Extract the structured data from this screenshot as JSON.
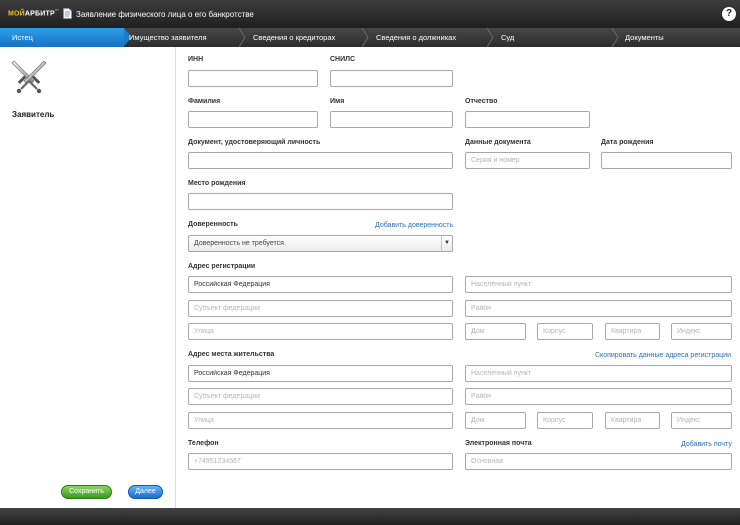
{
  "app": {
    "logo_prefix": "МОЙ",
    "logo_main": "АРБИТР",
    "logo_tm": "™",
    "title": "Заявление физического лица о его банкротстве",
    "help": "?"
  },
  "steps": [
    {
      "label": "Истец",
      "active": true
    },
    {
      "label": "Имущество заявителя"
    },
    {
      "label": "Сведения о кредиторах"
    },
    {
      "label": "Сведения о должниках"
    },
    {
      "label": "Суд"
    },
    {
      "label": "Документы"
    }
  ],
  "sidebar": {
    "title": "Заявитель",
    "save": "Сохранить",
    "next": "Далее"
  },
  "form": {
    "inn_label": "ИНН",
    "snils_label": "СНИЛС",
    "last_name_label": "Фамилия",
    "first_name_label": "Имя",
    "patronymic_label": "Отчество",
    "id_doc_label": "Документ, удостоверяющий личность",
    "doc_data_label": "Данные документа",
    "doc_data_placeholder": "Серия и номер",
    "birth_date_label": "Дата рождения",
    "birth_place_label": "Место рождения",
    "poa_label": "Доверенность",
    "poa_add": "Добавить доверенность",
    "poa_value": "Доверенность не требуется",
    "reg_address_label": "Адрес регистрации",
    "res_address_label": "Адрес места жительства",
    "copy_reg": "Скопировать данные адреса регистрации",
    "country_value": "Российская Федерация",
    "locality_ph": "Населенный пункт",
    "region_ph": "Субъект федерации",
    "district_ph": "Район",
    "street_ph": "Улица",
    "house_ph": "Дом",
    "korpus_ph": "Корпус",
    "flat_ph": "Квартира",
    "index_ph": "Индекс",
    "phone_label": "Телефон",
    "phone_ph": "+74951234567",
    "email_label": "Электронная почта",
    "email_add": "Добавить почту",
    "email_ph": "Основная"
  },
  "colors": {
    "accent": "#1a7ccb",
    "save_green": "#3a9a20",
    "link": "#2a6fb8"
  }
}
